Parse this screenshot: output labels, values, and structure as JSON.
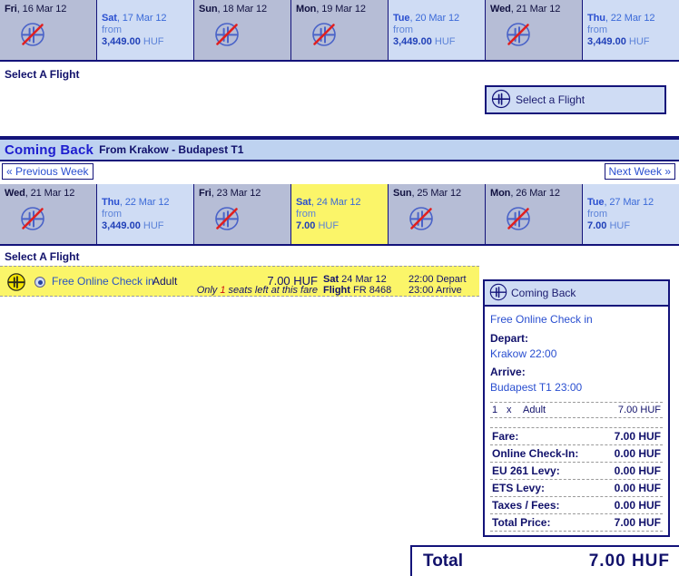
{
  "outbound": {
    "days": [
      {
        "dow": "Fri",
        "date": ", 16 Mar 12",
        "state": "unavail",
        "from": "",
        "price": "",
        "currency": ""
      },
      {
        "dow": "Sat",
        "date": ", 17 Mar 12",
        "state": "avail",
        "from": "from",
        "price": "3,449.00",
        "currency": "HUF"
      },
      {
        "dow": "Sun",
        "date": ", 18 Mar 12",
        "state": "unavail",
        "from": "",
        "price": "",
        "currency": ""
      },
      {
        "dow": "Mon",
        "date": ", 19 Mar 12",
        "state": "unavail",
        "from": "",
        "price": "",
        "currency": ""
      },
      {
        "dow": "Tue",
        "date": ", 20 Mar 12",
        "state": "avail",
        "from": "from",
        "price": "3,449.00",
        "currency": "HUF"
      },
      {
        "dow": "Wed",
        "date": ", 21 Mar 12",
        "state": "unavail",
        "from": "",
        "price": "",
        "currency": ""
      },
      {
        "dow": "Thu",
        "date": ", 22 Mar 12",
        "state": "avail",
        "from": "from",
        "price": "3,449.00",
        "currency": "HUF"
      }
    ],
    "select_title": "Select A Flight",
    "pick_button": "Select a Flight"
  },
  "coming_back": {
    "header_title": "Coming Back",
    "header_route": "From Krakow - Budapest T1",
    "prev_week": "« Previous Week",
    "next_week": "Next Week »",
    "days": [
      {
        "dow": "Wed",
        "date": ", 21 Mar 12",
        "state": "unavail",
        "from": "",
        "price": "",
        "currency": ""
      },
      {
        "dow": "Thu",
        "date": ", 22 Mar 12",
        "state": "avail",
        "from": "from",
        "price": "3,449.00",
        "currency": "HUF"
      },
      {
        "dow": "Fri",
        "date": ", 23 Mar 12",
        "state": "unavail",
        "from": "",
        "price": "",
        "currency": ""
      },
      {
        "dow": "Sat",
        "date": ", 24 Mar 12",
        "state": "selected",
        "from": "from",
        "price": "7.00",
        "currency": "HUF"
      },
      {
        "dow": "Sun",
        "date": ", 25 Mar 12",
        "state": "unavail",
        "from": "",
        "price": "",
        "currency": ""
      },
      {
        "dow": "Mon",
        "date": ", 26 Mar 12",
        "state": "unavail",
        "from": "",
        "price": "",
        "currency": ""
      },
      {
        "dow": "Tue",
        "date": ", 27 Mar 12",
        "state": "avail",
        "from": "from",
        "price": "7.00",
        "currency": "HUF"
      }
    ],
    "select_title": "Select A Flight",
    "fare": {
      "label": "Free Online Check in",
      "passenger_type": "Adult",
      "price": "7.00 HUF",
      "seats_prefix": "Only ",
      "seats_count": "1",
      "seats_suffix": " seats left at this fare",
      "depart_day": "Sat",
      "depart_date": " 24 Mar 12",
      "depart_time": "22:00 Depart",
      "flight_label": "Flight",
      "flight_number": " FR 8468",
      "arrive_time": "23:00 Arrive"
    }
  },
  "summary": {
    "title": "Coming Back",
    "fare_type": "Free Online Check in",
    "depart_label": "Depart:",
    "depart_value": "Krakow 22:00",
    "arrive_label": "Arrive:",
    "arrive_value": "Budapest T1 23:00",
    "pax_rows": [
      {
        "qty": "1",
        "x": "x",
        "type": "Adult",
        "amount": "7.00 HUF"
      }
    ],
    "totals": [
      {
        "label": "Fare:",
        "value": "7.00 HUF"
      },
      {
        "label": "Online Check-In:",
        "value": "0.00 HUF"
      },
      {
        "label": "EU 261 Levy:",
        "value": "0.00 HUF"
      },
      {
        "label": "ETS Levy:",
        "value": "0.00 HUF"
      },
      {
        "label": "Taxes / Fees:",
        "value": "0.00 HUF"
      },
      {
        "label": "Total Price:",
        "value": "7.00 HUF"
      }
    ]
  },
  "grand_total": {
    "label": "Total",
    "value": "7.00  HUF"
  }
}
